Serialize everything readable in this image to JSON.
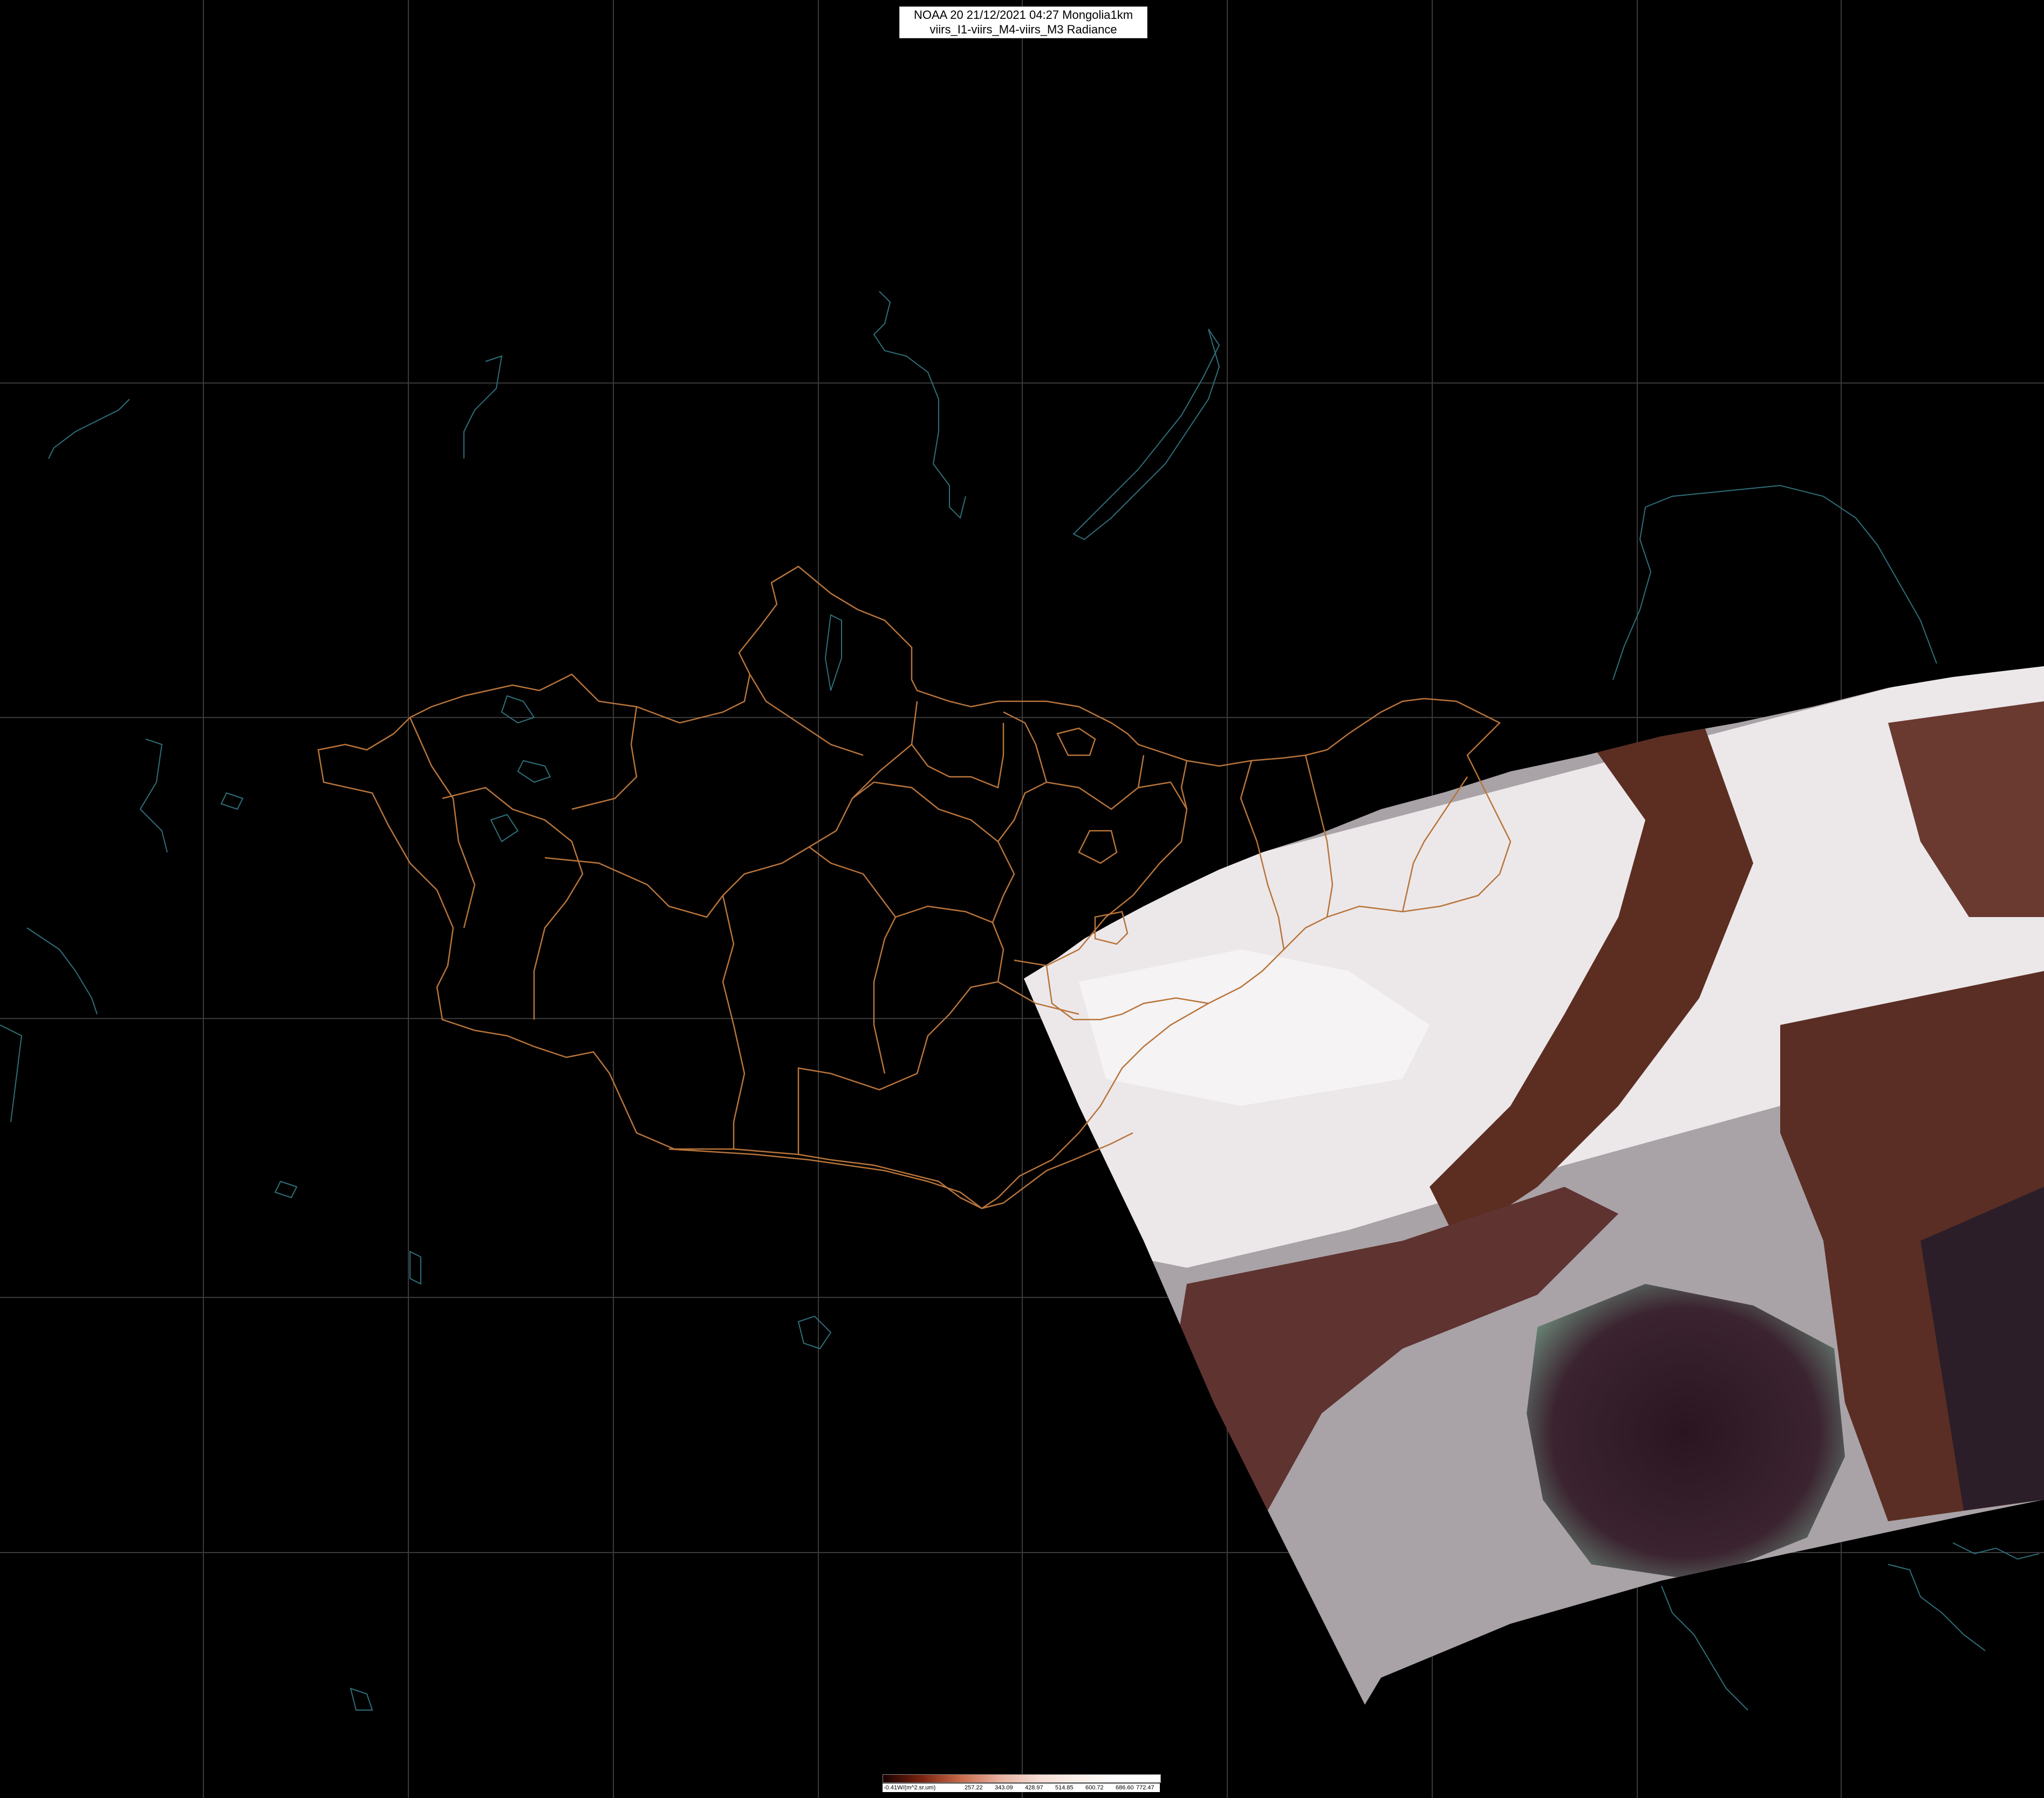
{
  "title": {
    "line1": "NOAA 20 21/12/2021 04:27 Mongolia1km",
    "line2": "viirs_I1-viirs_M4-viirs_M3 Radiance"
  },
  "legend": {
    "labels": [
      "-0.41W/(m^2.sr.um)",
      "257.22",
      "343.09",
      "428.97",
      "514.85",
      "600.72",
      "686.60",
      "772.47"
    ]
  },
  "colors": {
    "background": "#000000",
    "graticule": "#3a3a3a",
    "mongolia_border": "#b8743a",
    "coast_lakes": "#2f6f7a",
    "snow": "#f2eef0",
    "terrain_brown": "#5a2a1e",
    "sea": "#2a1a22",
    "haze": "#a8a4a6"
  }
}
